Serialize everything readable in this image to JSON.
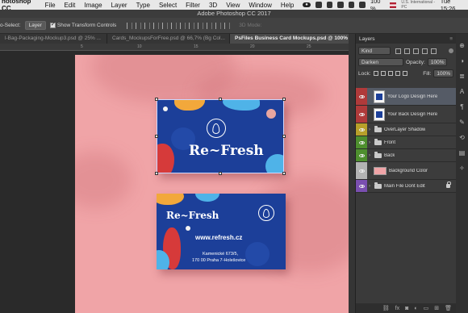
{
  "menubar": {
    "app": "hotoshop CC",
    "items": [
      "File",
      "Edit",
      "Image",
      "Layer",
      "Type",
      "Select",
      "Filter",
      "3D",
      "View",
      "Window",
      "Help"
    ],
    "battery": "100 %",
    "input_source": "U.S. International - PC",
    "clock": "Tue 15:26"
  },
  "title": "Adobe Photoshop CC 2017",
  "options": {
    "auto_select_label": "o-Select:",
    "auto_select_value": "Layer",
    "transform_label": "Show Transform Controls",
    "mode_3d": "3D Mode:"
  },
  "tabs": [
    {
      "label": "l-Bag-Packaging-Mockup3.psd @ 25% ...",
      "active": false
    },
    {
      "label": "Cards_MockupsForFree.psd @ 66,7% (Bg Col...",
      "active": false
    },
    {
      "label": "PsFiles Business Card Mockups.psd @ 100% (Y...",
      "active": true
    }
  ],
  "ruler": [
    "5",
    "10",
    "15",
    "20",
    "25"
  ],
  "card_front": {
    "brand": "Re~Fresh"
  },
  "card_back": {
    "brand": "Re~Fresh",
    "url": "www.refresh.cz",
    "address1": "Kamenické 673/5,",
    "address2": "170 00 Praha 7-Holešovice"
  },
  "layers_panel": {
    "title": "Layers",
    "kind": "Kind",
    "blend_mode": "Darken",
    "opacity_label": "Opacity:",
    "opacity_value": "100%",
    "lock_label": "Lock:",
    "fill_label": "Fill:",
    "fill_value": "100%",
    "layers": [
      {
        "name": "Your Logo Design Here",
        "color": "#b03a3a",
        "type": "smart",
        "selected": true
      },
      {
        "name": "Your Back Design Here",
        "color": "#b03a3a",
        "type": "smart",
        "selected": false
      },
      {
        "name": "OverLayer Shadow",
        "color": "#b8a02a",
        "type": "folder",
        "selected": false
      },
      {
        "name": "Front",
        "color": "#4e8f2e",
        "type": "folder",
        "selected": false
      },
      {
        "name": "Back",
        "color": "#4e8f2e",
        "type": "folder",
        "selected": false
      },
      {
        "name": "Background Color",
        "color": "#b3b3b3",
        "type": "fill",
        "selected": false
      },
      {
        "name": "Main File Dont Edit",
        "color": "#7a4fb0",
        "type": "folder",
        "selected": false
      }
    ]
  },
  "colors": {
    "canvas": "#f0a4a7",
    "card": "#1c3f99",
    "accent_orange": "#f2a83b",
    "accent_cyan": "#4fb3e8",
    "accent_red": "#d63a3a"
  }
}
